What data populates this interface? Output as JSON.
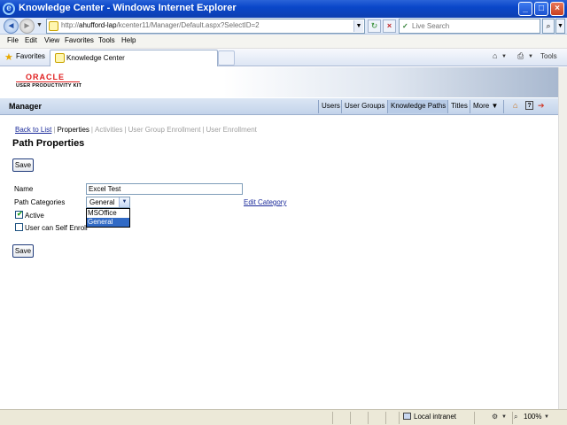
{
  "window": {
    "title": "Knowledge Center - Windows Internet Explorer"
  },
  "addressbar": {
    "url_prefix": "http://",
    "url_host": "ahufford-lap",
    "url_path": "/kcenter11/Manager/Default.aspx?SelectID=2",
    "search_placeholder": "Live Search"
  },
  "menubar": {
    "items": [
      "File",
      "Edit",
      "View",
      "Favorites",
      "Tools",
      "Help"
    ]
  },
  "favbar": {
    "favorites_label": "Favorites",
    "tab_label": "Knowledge Center",
    "tools_label": "Tools"
  },
  "banner": {
    "brand": "ORACLE",
    "product": "USER PRODUCTIVITY KIT"
  },
  "manager": {
    "title": "Manager",
    "tabs": [
      "Users",
      "User Groups",
      "Knowledge Paths",
      "Titles",
      "More ▼"
    ],
    "active_tab": "Knowledge Paths"
  },
  "subnav": {
    "back": "Back to List",
    "properties": "Properties",
    "activities": "Activities",
    "group_enrollment": "User Group Enrollment",
    "user_enrollment": "User Enrollment"
  },
  "page": {
    "title": "Path Properties",
    "save_label": "Save"
  },
  "form": {
    "name_label": "Name",
    "name_value": "Excel Test",
    "categories_label": "Path Categories",
    "category_selected": "General",
    "category_options": [
      "MSOffice",
      "General"
    ],
    "edit_category": "Edit Category",
    "active_label": "Active",
    "active_checked": true,
    "self_enroll_label": "User can Self Enroll",
    "self_enroll_checked": false
  },
  "statusbar": {
    "zone": "Local intranet",
    "zoom": "100%"
  }
}
